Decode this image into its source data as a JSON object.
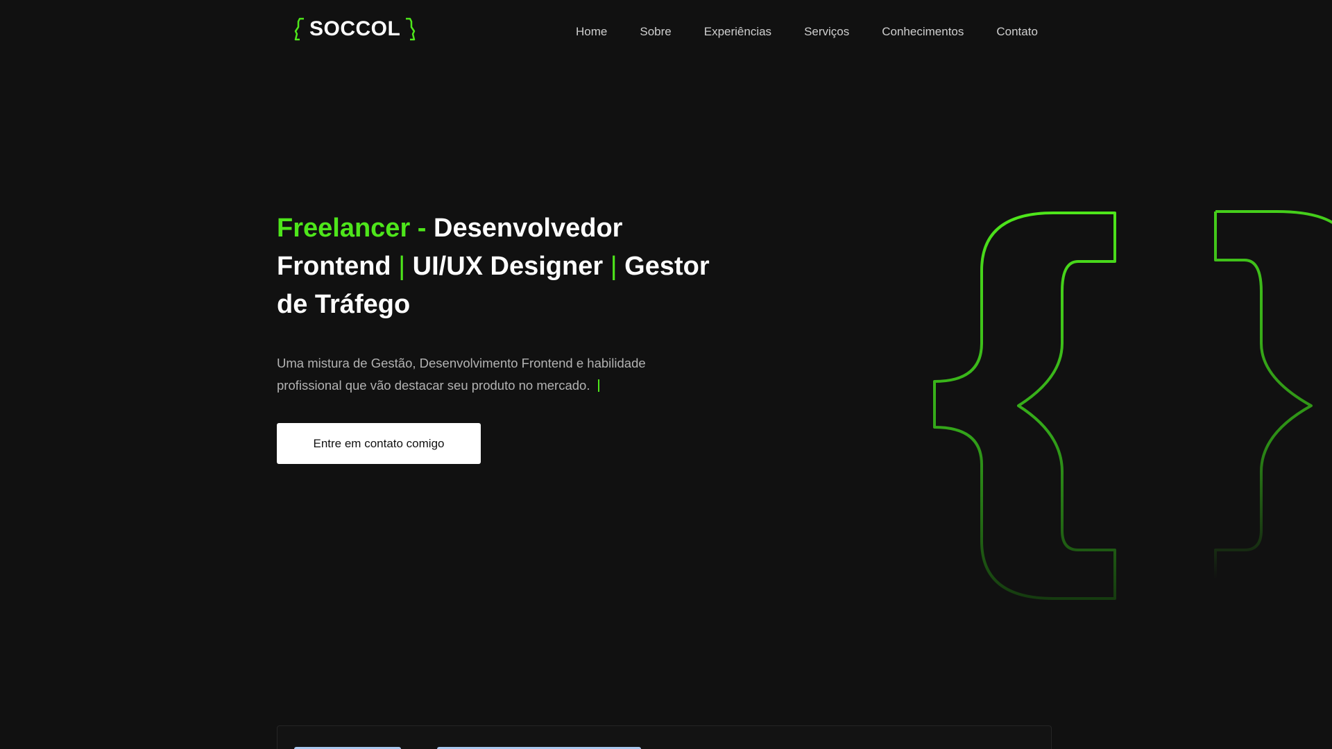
{
  "brand": {
    "name": "SOCCOL",
    "accent": "#4ee61b",
    "background": "#111111"
  },
  "nav": {
    "items": [
      {
        "label": "Home"
      },
      {
        "label": "Sobre"
      },
      {
        "label": "Experiências"
      },
      {
        "label": "Serviços"
      },
      {
        "label": "Conhecimentos"
      },
      {
        "label": "Contato"
      }
    ]
  },
  "hero": {
    "title_highlight": "Freelancer -",
    "title_part1": "Desenvolvedor Frontend",
    "separator": "|",
    "title_part2": "UI/UX Designer",
    "title_part3": "Gestor de Tráfego",
    "subtitle": "Uma mistura de Gestão, Desenvolvimento Frontend e habilidade profissional que vão destacar seu produto no mercado.",
    "cta_label": "Entre em contato comigo"
  },
  "icons": {
    "logo_brackets": "code-bracket-icon",
    "hero_decoration": "curly-braces-icon"
  }
}
